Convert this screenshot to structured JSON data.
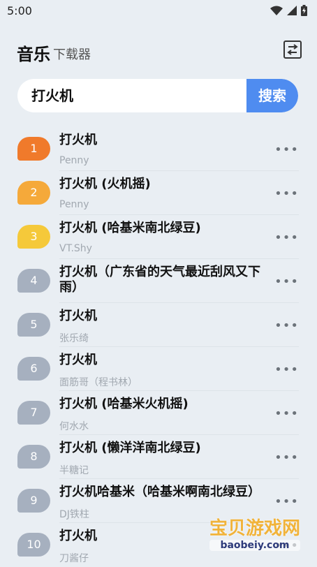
{
  "status": {
    "time": "5:00"
  },
  "header": {
    "title": "音乐",
    "subtitle": "下载器"
  },
  "search": {
    "value": "打火机",
    "button_label": "搜索"
  },
  "results": [
    {
      "rank": "1",
      "title": "打火机",
      "artist": "Penny",
      "color": "#f07a2b"
    },
    {
      "rank": "2",
      "title": "打火机 (火机摇)",
      "artist": "Penny",
      "color": "#f5a93a"
    },
    {
      "rank": "3",
      "title": "打火机 (哈基米南北绿豆)",
      "artist": "VT.Shy",
      "color": "#f5c93a"
    },
    {
      "rank": "4",
      "title": "打火机（广东省的天气最近刮风又下雨）",
      "artist": "",
      "color": "#a6b0bf"
    },
    {
      "rank": "5",
      "title": "打火机",
      "artist": "张乐绮",
      "color": "#a6b0bf"
    },
    {
      "rank": "6",
      "title": "打火机",
      "artist": "面筋哥（程书林）",
      "color": "#a6b0bf"
    },
    {
      "rank": "7",
      "title": "打火机 (哈基米火机摇)",
      "artist": "何水水",
      "color": "#a6b0bf"
    },
    {
      "rank": "8",
      "title": "打火机 (懒洋洋南北绿豆)",
      "artist": "半糖记",
      "color": "#a6b0bf"
    },
    {
      "rank": "9",
      "title": "打火机哈基米（哈基米啊南北绿豆）",
      "artist": "DJ铁柱",
      "color": "#a6b0bf"
    },
    {
      "rank": "10",
      "title": "打火机",
      "artist": "刀酱仔",
      "color": "#a6b0bf"
    }
  ],
  "more_label": "•••",
  "watermark": {
    "title": "宝贝游戏网",
    "url": "baobeiy.com"
  },
  "icons": {
    "wifi": "wifi-icon",
    "signal": "signal-icon",
    "battery": "battery-icon",
    "header_action": "swap-list-icon",
    "more": "more-icon"
  }
}
